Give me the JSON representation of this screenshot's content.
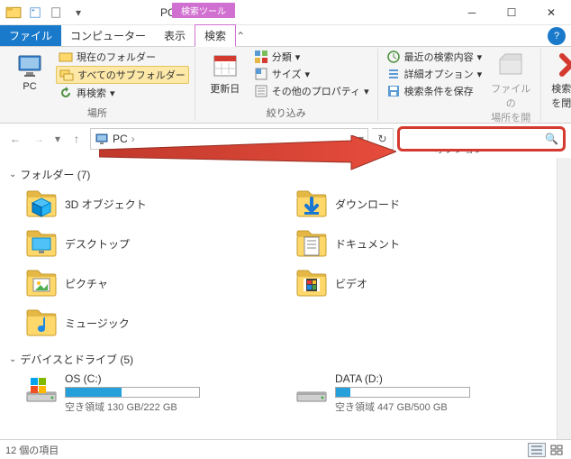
{
  "title_tools": "検索ツール",
  "title": "PC",
  "tabs": {
    "file": "ファイル",
    "computer": "コンピューター",
    "view": "表示",
    "search": "検索"
  },
  "ribbon": {
    "location": {
      "pc_label": "PC",
      "current": "現在のフォルダー",
      "all_sub": "すべてのサブフォルダー",
      "research": "再検索",
      "group": "場所"
    },
    "refine": {
      "update": "更新日",
      "type": "分類",
      "size": "サイズ",
      "other": "その他のプロパティ",
      "group": "絞り込み"
    },
    "options": {
      "recent": "最近の検索内容",
      "advanced": "詳細オプション",
      "save": "検索条件を保存",
      "open_loc1": "ファイルの",
      "open_loc2": "場所を開く",
      "group": "オプション"
    },
    "close": {
      "label1": "検索結果",
      "label2": "を閉じる"
    }
  },
  "address": {
    "text": "PC"
  },
  "search": {
    "value": ""
  },
  "groups": {
    "folders": {
      "label": "フォルダー (7)"
    },
    "drives": {
      "label": "デバイスとドライブ (5)"
    }
  },
  "folders": [
    {
      "label": "3D オブジェクト",
      "icon": "object3d"
    },
    {
      "label": "ダウンロード",
      "icon": "download"
    },
    {
      "label": "デスクトップ",
      "icon": "desktop"
    },
    {
      "label": "ドキュメント",
      "icon": "document"
    },
    {
      "label": "ピクチャ",
      "icon": "picture"
    },
    {
      "label": "ビデオ",
      "icon": "video"
    },
    {
      "label": "ミュージック",
      "icon": "music"
    }
  ],
  "drives": [
    {
      "name": "OS (C:)",
      "free": "空き領域 130 GB/222 GB",
      "fill": 0.42
    },
    {
      "name": "DATA (D:)",
      "free": "空き領域 447 GB/500 GB",
      "fill": 0.11
    }
  ],
  "status": "12 個の項目"
}
